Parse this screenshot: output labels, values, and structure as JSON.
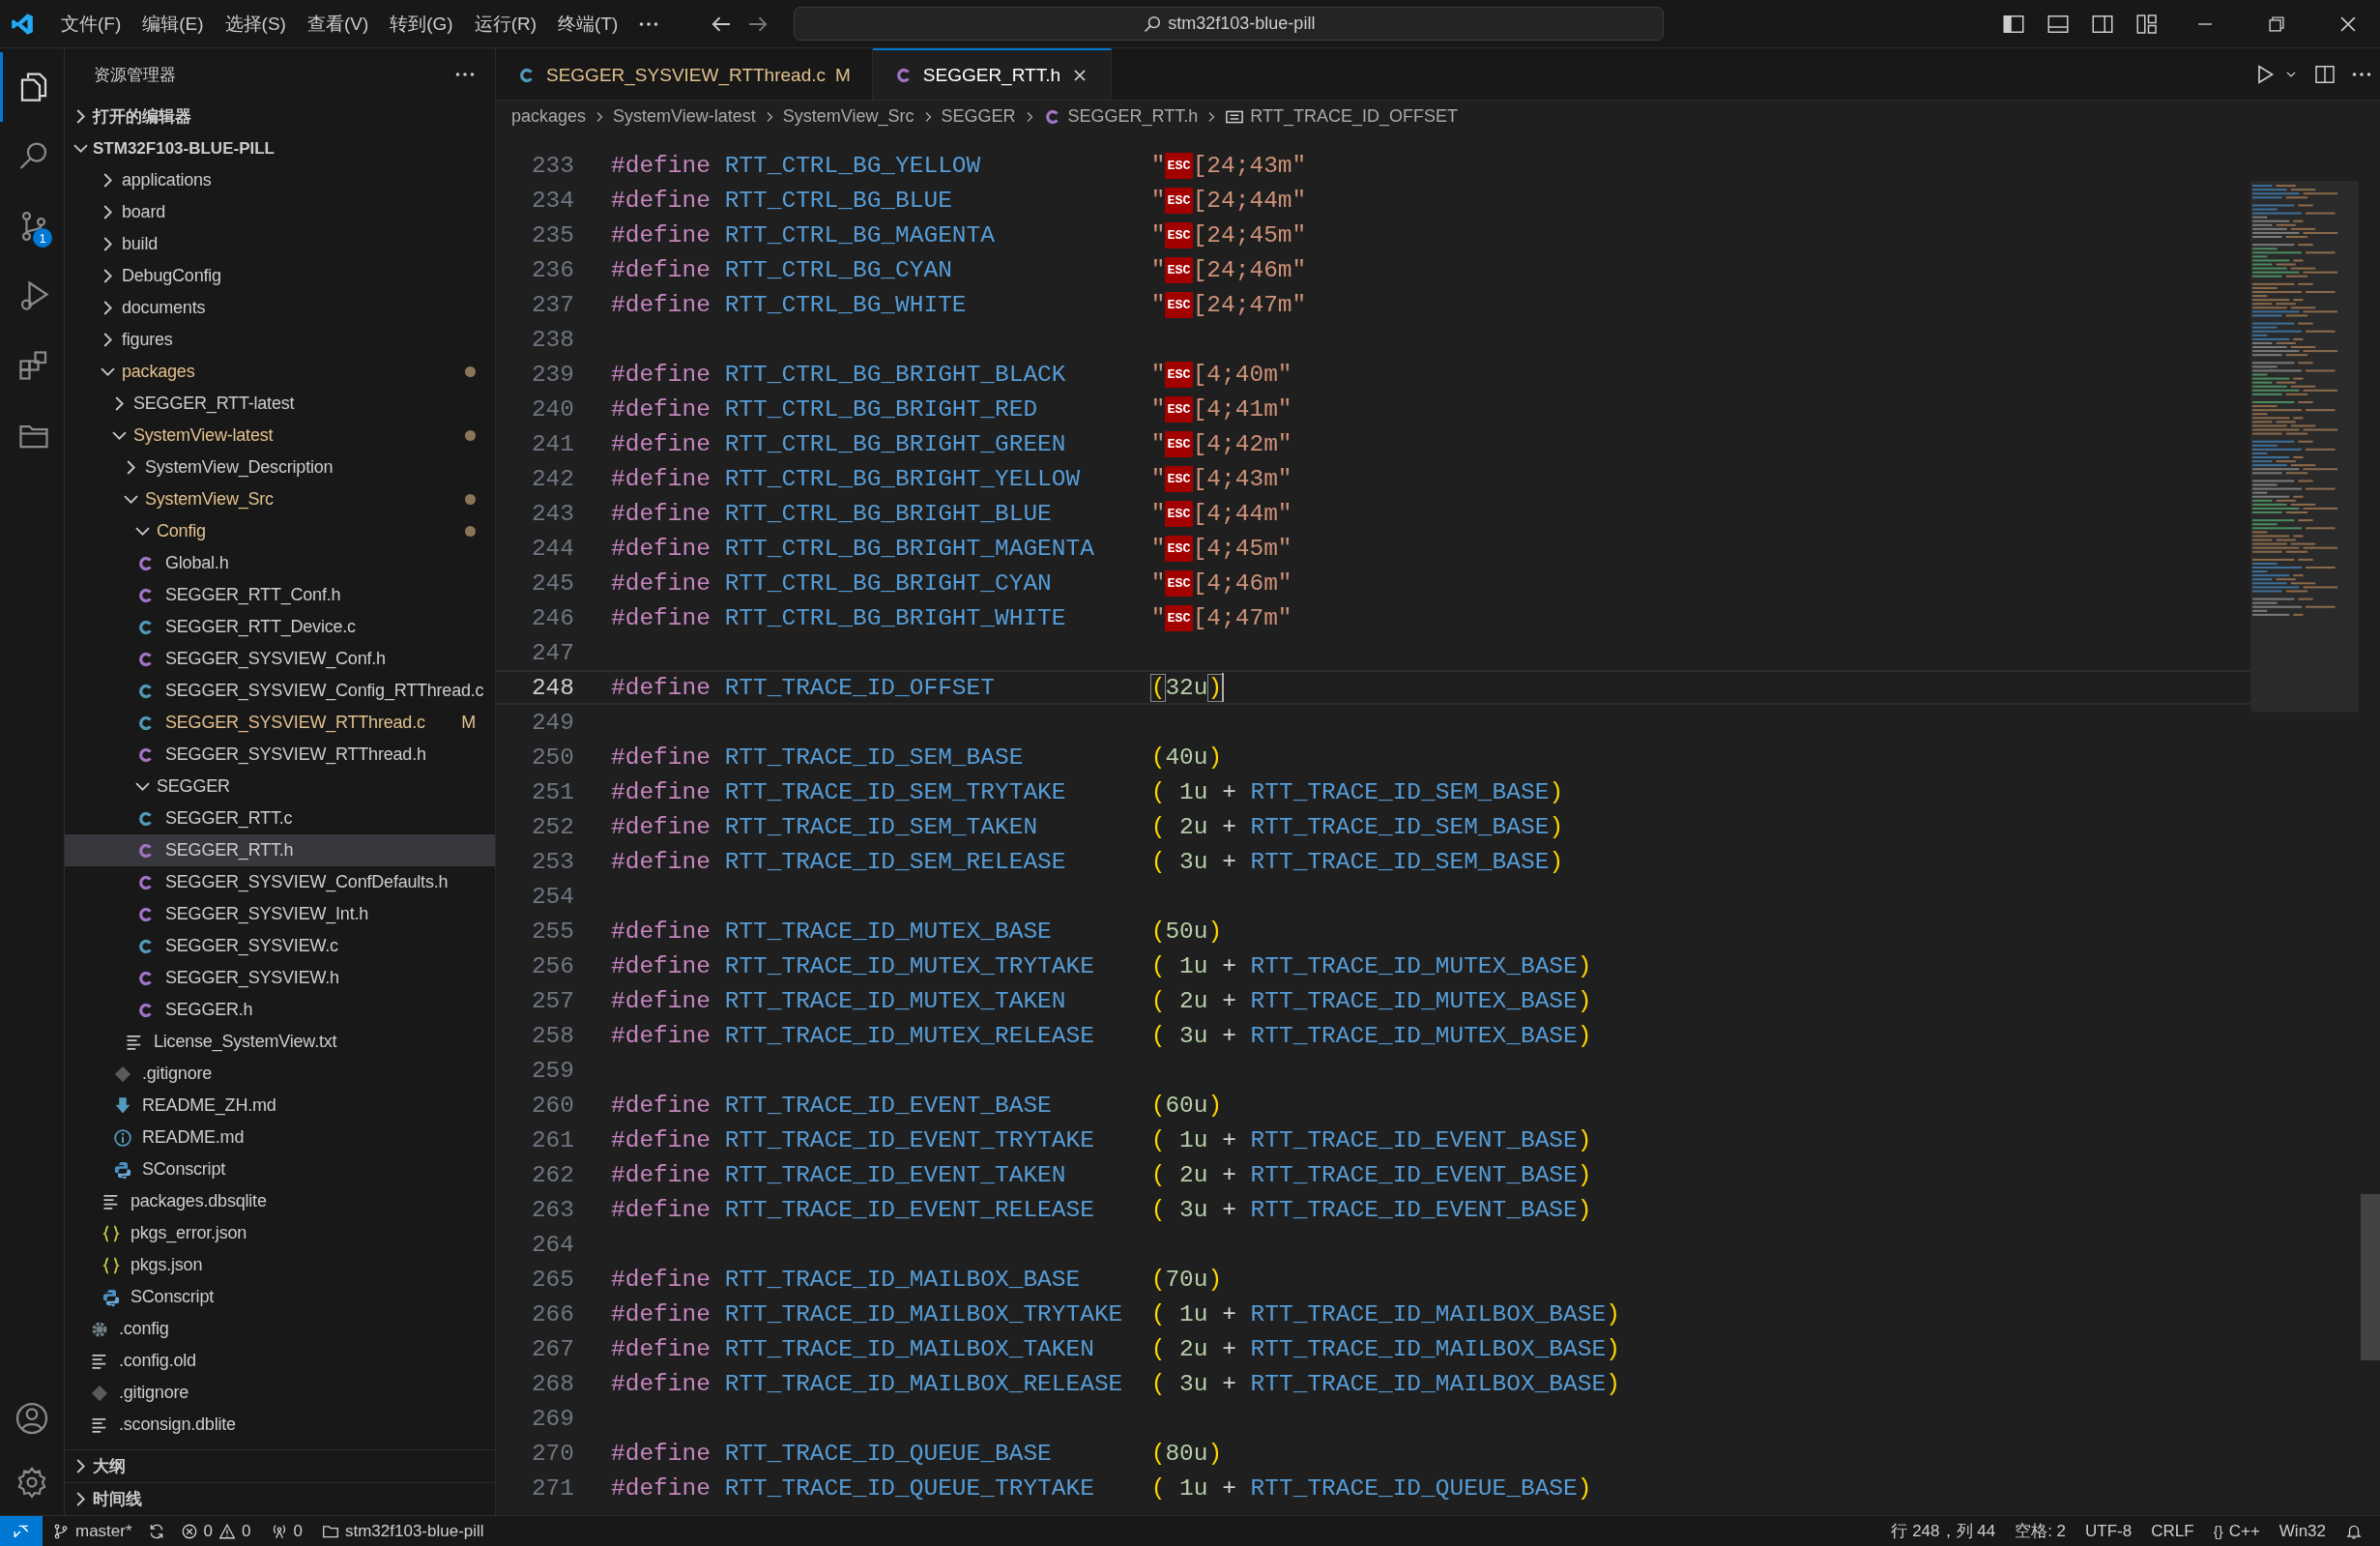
{
  "title_bar": {
    "menus": [
      "文件(F)",
      "编辑(E)",
      "选择(S)",
      "查看(V)",
      "转到(G)",
      "运行(R)",
      "终端(T)"
    ],
    "search": "stm32f103-blue-pill"
  },
  "activity_bar": [
    {
      "kind": "files",
      "selected": true
    },
    {
      "kind": "search",
      "selected": false
    },
    {
      "kind": "source-control",
      "selected": false,
      "badge": "1"
    },
    {
      "kind": "run-debug",
      "selected": false
    },
    {
      "kind": "extensions",
      "selected": false
    },
    {
      "kind": "folder",
      "selected": false
    }
  ],
  "sidebar": {
    "title": "资源管理器",
    "open_editors": {
      "label": "打开的编辑器",
      "expanded": false
    },
    "project": {
      "label": "STM32F103-BLUE-PILL",
      "expanded": true
    },
    "tree": [
      {
        "label": "applications",
        "kind": "folder",
        "expanded": false,
        "changed": false,
        "selected": false
      },
      {
        "label": "board",
        "kind": "folder",
        "expanded": false,
        "changed": false,
        "selected": false
      },
      {
        "label": "build",
        "kind": "folder",
        "expanded": false,
        "changed": false,
        "selected": false
      },
      {
        "label": "DebugConfig",
        "kind": "folder",
        "expanded": false,
        "changed": false,
        "selected": false
      },
      {
        "label": "documents",
        "kind": "folder",
        "expanded": false,
        "changed": false,
        "selected": false
      },
      {
        "label": "figures",
        "kind": "folder",
        "expanded": false,
        "changed": false,
        "selected": false
      },
      {
        "label": "packages",
        "kind": "folder",
        "expanded": true,
        "changed": true,
        "selected": false,
        "children": [
          {
            "label": "SEGGER_RTT-latest",
            "kind": "folder",
            "expanded": false,
            "changed": false,
            "selected": false
          },
          {
            "label": "SystemView-latest",
            "kind": "folder",
            "expanded": true,
            "changed": true,
            "selected": false,
            "children": [
              {
                "label": "SystemView_Description",
                "kind": "folder",
                "expanded": false,
                "changed": false,
                "selected": false
              },
              {
                "label": "SystemView_Src",
                "kind": "folder",
                "expanded": true,
                "changed": true,
                "selected": false,
                "children": [
                  {
                    "label": "Config",
                    "kind": "folder",
                    "expanded": true,
                    "changed": true,
                    "selected": false,
                    "children": [
                      {
                        "label": "Global.h",
                        "kind": "c_header",
                        "selected": false
                      },
                      {
                        "label": "SEGGER_RTT_Conf.h",
                        "kind": "c_header",
                        "selected": false
                      },
                      {
                        "label": "SEGGER_RTT_Device.c",
                        "kind": "c_source",
                        "selected": false
                      },
                      {
                        "label": "SEGGER_SYSVIEW_Conf.h",
                        "kind": "c_header",
                        "selected": false
                      },
                      {
                        "label": "SEGGER_SYSVIEW_Config_RTThread.c",
                        "kind": "c_source",
                        "selected": false
                      },
                      {
                        "label": "SEGGER_SYSVIEW_RTThread.c",
                        "kind": "c_source",
                        "selected": false,
                        "badge": "M"
                      },
                      {
                        "label": "SEGGER_SYSVIEW_RTThread.h",
                        "kind": "c_header",
                        "selected": false
                      }
                    ]
                  },
                  {
                    "label": "SEGGER",
                    "kind": "folder",
                    "expanded": true,
                    "changed": false,
                    "selected": false,
                    "children": [
                      {
                        "label": "SEGGER_RTT.c",
                        "kind": "c_source",
                        "selected": false
                      },
                      {
                        "label": "SEGGER_RTT.h",
                        "kind": "c_header",
                        "selected": true
                      },
                      {
                        "label": "SEGGER_SYSVIEW_ConfDefaults.h",
                        "kind": "c_header",
                        "selected": false
                      },
                      {
                        "label": "SEGGER_SYSVIEW_Int.h",
                        "kind": "c_header",
                        "selected": false
                      },
                      {
                        "label": "SEGGER_SYSVIEW.c",
                        "kind": "c_source",
                        "selected": false
                      },
                      {
                        "label": "SEGGER_SYSVIEW.h",
                        "kind": "c_header",
                        "selected": false
                      },
                      {
                        "label": "SEGGER.h",
                        "kind": "c_header",
                        "selected": false
                      }
                    ]
                  },
                  {
                    "label": "License_SystemView.txt",
                    "kind": "text",
                    "selected": false
                  }
                ]
              },
              {
                "label": ".gitignore",
                "kind": "git",
                "selected": false
              },
              {
                "label": "README_ZH.md",
                "kind": "download",
                "selected": false
              },
              {
                "label": "README.md",
                "kind": "info",
                "selected": false
              },
              {
                "label": "SConscript",
                "kind": "python",
                "selected": false
              }
            ]
          },
          {
            "label": "packages.dbsqlite",
            "kind": "text",
            "selected": false
          },
          {
            "label": "pkgs_error.json",
            "kind": "json",
            "selected": false
          },
          {
            "label": "pkgs.json",
            "kind": "json",
            "selected": false
          },
          {
            "label": "SConscript",
            "kind": "python",
            "selected": false
          }
        ]
      },
      {
        "label": ".config",
        "kind": "gear",
        "selected": false
      },
      {
        "label": ".config.old",
        "kind": "text",
        "selected": false
      },
      {
        "label": ".gitignore",
        "kind": "git",
        "selected": false
      },
      {
        "label": ".sconsign.dblite",
        "kind": "text",
        "selected": false
      }
    ],
    "sections": [
      {
        "label": "大纲",
        "expanded": false
      },
      {
        "label": "时间线",
        "expanded": false
      }
    ]
  },
  "tabs": [
    {
      "label": "SEGGER_SYSVIEW_RTThread.c",
      "kind": "c_source",
      "badge": "M",
      "selected": false
    },
    {
      "label": "SEGGER_RTT.h",
      "kind": "c_header",
      "selected": true
    }
  ],
  "breadcrumbs": [
    {
      "kind": "folder",
      "text": "packages"
    },
    {
      "kind": "folder",
      "text": "SystemView-latest"
    },
    {
      "kind": "folder",
      "text": "SystemView_Src"
    },
    {
      "kind": "folder",
      "text": "SEGGER"
    },
    {
      "kind": "c_header",
      "text": "SEGGER_RTT.h"
    },
    {
      "kind": "symbol",
      "text": "RTT_TRACE_ID_OFFSET"
    }
  ],
  "code": [
    {
      "number": "233",
      "current": false,
      "directive": "#define",
      "name": "RTT_CTRL_BG_YELLOW",
      "value": [
        {
          "kind": "string",
          "text": "\""
        },
        {
          "kind": "control",
          "text": "ESC"
        },
        {
          "kind": "string",
          "text": "[24;43m\""
        }
      ]
    },
    {
      "number": "234",
      "current": false,
      "directive": "#define",
      "name": "RTT_CTRL_BG_BLUE",
      "value": [
        {
          "kind": "string",
          "text": "\""
        },
        {
          "kind": "control",
          "text": "ESC"
        },
        {
          "kind": "string",
          "text": "[24;44m\""
        }
      ]
    },
    {
      "number": "235",
      "current": false,
      "directive": "#define",
      "name": "RTT_CTRL_BG_MAGENTA",
      "value": [
        {
          "kind": "string",
          "text": "\""
        },
        {
          "kind": "control",
          "text": "ESC"
        },
        {
          "kind": "string",
          "text": "[24;45m\""
        }
      ]
    },
    {
      "number": "236",
      "current": false,
      "directive": "#define",
      "name": "RTT_CTRL_BG_CYAN",
      "value": [
        {
          "kind": "string",
          "text": "\""
        },
        {
          "kind": "control",
          "text": "ESC"
        },
        {
          "kind": "string",
          "text": "[24;46m\""
        }
      ]
    },
    {
      "number": "237",
      "current": false,
      "directive": "#define",
      "name": "RTT_CTRL_BG_WHITE",
      "value": [
        {
          "kind": "string",
          "text": "\""
        },
        {
          "kind": "control",
          "text": "ESC"
        },
        {
          "kind": "string",
          "text": "[24;47m\""
        }
      ]
    },
    {
      "number": "238",
      "current": false
    },
    {
      "number": "239",
      "current": false,
      "directive": "#define",
      "name": "RTT_CTRL_BG_BRIGHT_BLACK",
      "value": [
        {
          "kind": "string",
          "text": "\""
        },
        {
          "kind": "control",
          "text": "ESC"
        },
        {
          "kind": "string",
          "text": "[4;40m\""
        }
      ]
    },
    {
      "number": "240",
      "current": false,
      "directive": "#define",
      "name": "RTT_CTRL_BG_BRIGHT_RED",
      "value": [
        {
          "kind": "string",
          "text": "\""
        },
        {
          "kind": "control",
          "text": "ESC"
        },
        {
          "kind": "string",
          "text": "[4;41m\""
        }
      ]
    },
    {
      "number": "241",
      "current": false,
      "directive": "#define",
      "name": "RTT_CTRL_BG_BRIGHT_GREEN",
      "value": [
        {
          "kind": "string",
          "text": "\""
        },
        {
          "kind": "control",
          "text": "ESC"
        },
        {
          "kind": "string",
          "text": "[4;42m\""
        }
      ]
    },
    {
      "number": "242",
      "current": false,
      "directive": "#define",
      "name": "RTT_CTRL_BG_BRIGHT_YELLOW",
      "value": [
        {
          "kind": "string",
          "text": "\""
        },
        {
          "kind": "control",
          "text": "ESC"
        },
        {
          "kind": "string",
          "text": "[4;43m\""
        }
      ]
    },
    {
      "number": "243",
      "current": false,
      "directive": "#define",
      "name": "RTT_CTRL_BG_BRIGHT_BLUE",
      "value": [
        {
          "kind": "string",
          "text": "\""
        },
        {
          "kind": "control",
          "text": "ESC"
        },
        {
          "kind": "string",
          "text": "[4;44m\""
        }
      ]
    },
    {
      "number": "244",
      "current": false,
      "directive": "#define",
      "name": "RTT_CTRL_BG_BRIGHT_MAGENTA",
      "value": [
        {
          "kind": "string",
          "text": "\""
        },
        {
          "kind": "control",
          "text": "ESC"
        },
        {
          "kind": "string",
          "text": "[4;45m\""
        }
      ]
    },
    {
      "number": "245",
      "current": false,
      "directive": "#define",
      "name": "RTT_CTRL_BG_BRIGHT_CYAN",
      "value": [
        {
          "kind": "string",
          "text": "\""
        },
        {
          "kind": "control",
          "text": "ESC"
        },
        {
          "kind": "string",
          "text": "[4;46m\""
        }
      ]
    },
    {
      "number": "246",
      "current": false,
      "directive": "#define",
      "name": "RTT_CTRL_BG_BRIGHT_WHITE",
      "value": [
        {
          "kind": "string",
          "text": "\""
        },
        {
          "kind": "control",
          "text": "ESC"
        },
        {
          "kind": "string",
          "text": "[4;47m\""
        }
      ]
    },
    {
      "number": "247",
      "current": false
    },
    {
      "number": "248",
      "current": true,
      "directive": "#define",
      "name": "RTT_TRACE_ID_OFFSET",
      "value": [
        {
          "kind": "matched_bracket",
          "text": "("
        },
        {
          "kind": "number",
          "text": "32u"
        },
        {
          "kind": "matched_bracket",
          "text": ")"
        }
      ]
    },
    {
      "number": "249",
      "current": false
    },
    {
      "number": "250",
      "current": false,
      "directive": "#define",
      "name": "RTT_TRACE_ID_SEM_BASE",
      "value": [
        {
          "kind": "bracket",
          "text": "("
        },
        {
          "kind": "number",
          "text": "40u"
        },
        {
          "kind": "bracket",
          "text": ")"
        }
      ]
    },
    {
      "number": "251",
      "current": false,
      "directive": "#define",
      "name": "RTT_TRACE_ID_SEM_TRYTAKE",
      "value": [
        {
          "kind": "bracket",
          "text": "("
        },
        {
          "kind": "number",
          "text": " 1u"
        },
        {
          "kind": "operator",
          "text": " + "
        },
        {
          "kind": "macro",
          "text": "RTT_TRACE_ID_SEM_BASE"
        },
        {
          "kind": "bracket",
          "text": ")"
        }
      ]
    },
    {
      "number": "252",
      "current": false,
      "directive": "#define",
      "name": "RTT_TRACE_ID_SEM_TAKEN",
      "value": [
        {
          "kind": "bracket",
          "text": "("
        },
        {
          "kind": "number",
          "text": " 2u"
        },
        {
          "kind": "operator",
          "text": " + "
        },
        {
          "kind": "macro",
          "text": "RTT_TRACE_ID_SEM_BASE"
        },
        {
          "kind": "bracket",
          "text": ")"
        }
      ]
    },
    {
      "number": "253",
      "current": false,
      "directive": "#define",
      "name": "RTT_TRACE_ID_SEM_RELEASE",
      "value": [
        {
          "kind": "bracket",
          "text": "("
        },
        {
          "kind": "number",
          "text": " 3u"
        },
        {
          "kind": "operator",
          "text": " + "
        },
        {
          "kind": "macro",
          "text": "RTT_TRACE_ID_SEM_BASE"
        },
        {
          "kind": "bracket",
          "text": ")"
        }
      ]
    },
    {
      "number": "254",
      "current": false
    },
    {
      "number": "255",
      "current": false,
      "directive": "#define",
      "name": "RTT_TRACE_ID_MUTEX_BASE",
      "value": [
        {
          "kind": "bracket",
          "text": "("
        },
        {
          "kind": "number",
          "text": "50u"
        },
        {
          "kind": "bracket",
          "text": ")"
        }
      ]
    },
    {
      "number": "256",
      "current": false,
      "directive": "#define",
      "name": "RTT_TRACE_ID_MUTEX_TRYTAKE",
      "value": [
        {
          "kind": "bracket",
          "text": "("
        },
        {
          "kind": "number",
          "text": " 1u"
        },
        {
          "kind": "operator",
          "text": " + "
        },
        {
          "kind": "macro",
          "text": "RTT_TRACE_ID_MUTEX_BASE"
        },
        {
          "kind": "bracket",
          "text": ")"
        }
      ]
    },
    {
      "number": "257",
      "current": false,
      "directive": "#define",
      "name": "RTT_TRACE_ID_MUTEX_TAKEN",
      "value": [
        {
          "kind": "bracket",
          "text": "("
        },
        {
          "kind": "number",
          "text": " 2u"
        },
        {
          "kind": "operator",
          "text": " + "
        },
        {
          "kind": "macro",
          "text": "RTT_TRACE_ID_MUTEX_BASE"
        },
        {
          "kind": "bracket",
          "text": ")"
        }
      ]
    },
    {
      "number": "258",
      "current": false,
      "directive": "#define",
      "name": "RTT_TRACE_ID_MUTEX_RELEASE",
      "value": [
        {
          "kind": "bracket",
          "text": "("
        },
        {
          "kind": "number",
          "text": " 3u"
        },
        {
          "kind": "operator",
          "text": " + "
        },
        {
          "kind": "macro",
          "text": "RTT_TRACE_ID_MUTEX_BASE"
        },
        {
          "kind": "bracket",
          "text": ")"
        }
      ]
    },
    {
      "number": "259",
      "current": false
    },
    {
      "number": "260",
      "current": false,
      "directive": "#define",
      "name": "RTT_TRACE_ID_EVENT_BASE",
      "value": [
        {
          "kind": "bracket",
          "text": "("
        },
        {
          "kind": "number",
          "text": "60u"
        },
        {
          "kind": "bracket",
          "text": ")"
        }
      ]
    },
    {
      "number": "261",
      "current": false,
      "directive": "#define",
      "name": "RTT_TRACE_ID_EVENT_TRYTAKE",
      "value": [
        {
          "kind": "bracket",
          "text": "("
        },
        {
          "kind": "number",
          "text": " 1u"
        },
        {
          "kind": "operator",
          "text": " + "
        },
        {
          "kind": "macro",
          "text": "RTT_TRACE_ID_EVENT_BASE"
        },
        {
          "kind": "bracket",
          "text": ")"
        }
      ]
    },
    {
      "number": "262",
      "current": false,
      "directive": "#define",
      "name": "RTT_TRACE_ID_EVENT_TAKEN",
      "value": [
        {
          "kind": "bracket",
          "text": "("
        },
        {
          "kind": "number",
          "text": " 2u"
        },
        {
          "kind": "operator",
          "text": " + "
        },
        {
          "kind": "macro",
          "text": "RTT_TRACE_ID_EVENT_BASE"
        },
        {
          "kind": "bracket",
          "text": ")"
        }
      ]
    },
    {
      "number": "263",
      "current": false,
      "directive": "#define",
      "name": "RTT_TRACE_ID_EVENT_RELEASE",
      "value": [
        {
          "kind": "bracket",
          "text": "("
        },
        {
          "kind": "number",
          "text": " 3u"
        },
        {
          "kind": "operator",
          "text": " + "
        },
        {
          "kind": "macro",
          "text": "RTT_TRACE_ID_EVENT_BASE"
        },
        {
          "kind": "bracket",
          "text": ")"
        }
      ]
    },
    {
      "number": "264",
      "current": false
    },
    {
      "number": "265",
      "current": false,
      "directive": "#define",
      "name": "RTT_TRACE_ID_MAILBOX_BASE",
      "value": [
        {
          "kind": "bracket",
          "text": "("
        },
        {
          "kind": "number",
          "text": "70u"
        },
        {
          "kind": "bracket",
          "text": ")"
        }
      ]
    },
    {
      "number": "266",
      "current": false,
      "directive": "#define",
      "name": "RTT_TRACE_ID_MAILBOX_TRYTAKE",
      "value": [
        {
          "kind": "bracket",
          "text": "("
        },
        {
          "kind": "number",
          "text": " 1u"
        },
        {
          "kind": "operator",
          "text": " + "
        },
        {
          "kind": "macro",
          "text": "RTT_TRACE_ID_MAILBOX_BASE"
        },
        {
          "kind": "bracket",
          "text": ")"
        }
      ]
    },
    {
      "number": "267",
      "current": false,
      "directive": "#define",
      "name": "RTT_TRACE_ID_MAILBOX_TAKEN",
      "value": [
        {
          "kind": "bracket",
          "text": "("
        },
        {
          "kind": "number",
          "text": " 2u"
        },
        {
          "kind": "operator",
          "text": " + "
        },
        {
          "kind": "macro",
          "text": "RTT_TRACE_ID_MAILBOX_BASE"
        },
        {
          "kind": "bracket",
          "text": ")"
        }
      ]
    },
    {
      "number": "268",
      "current": false,
      "directive": "#define",
      "name": "RTT_TRACE_ID_MAILBOX_RELEASE",
      "value": [
        {
          "kind": "bracket",
          "text": "("
        },
        {
          "kind": "number",
          "text": " 3u"
        },
        {
          "kind": "operator",
          "text": " + "
        },
        {
          "kind": "macro",
          "text": "RTT_TRACE_ID_MAILBOX_BASE"
        },
        {
          "kind": "bracket",
          "text": ")"
        }
      ]
    },
    {
      "number": "269",
      "current": false
    },
    {
      "number": "270",
      "current": false,
      "directive": "#define",
      "name": "RTT_TRACE_ID_QUEUE_BASE",
      "value": [
        {
          "kind": "bracket",
          "text": "("
        },
        {
          "kind": "number",
          "text": "80u"
        },
        {
          "kind": "bracket",
          "text": ")"
        }
      ]
    },
    {
      "number": "271",
      "current": false,
      "directive": "#define",
      "name": "RTT_TRACE_ID_QUEUE_TRYTAKE",
      "value": [
        {
          "kind": "bracket",
          "text": "("
        },
        {
          "kind": "number",
          "text": " 1u"
        },
        {
          "kind": "operator",
          "text": " + "
        },
        {
          "kind": "macro",
          "text": "RTT_TRACE_ID_QUEUE_BASE"
        },
        {
          "kind": "bracket",
          "text": ")"
        }
      ]
    }
  ],
  "status_bar": {
    "branch": "master*",
    "errors": "0",
    "warnings": "0",
    "ports": "0",
    "folder": "stm32f103-blue-pill",
    "right": [
      {
        "kind": "text",
        "text": "行 248，列 44"
      },
      {
        "kind": "text",
        "text": "空格: 2"
      },
      {
        "kind": "text",
        "text": "UTF-8"
      },
      {
        "kind": "text",
        "text": "CRLF"
      },
      {
        "kind": "language",
        "icon": "{}",
        "text": "C++"
      },
      {
        "kind": "text",
        "text": "Win32"
      },
      {
        "kind": "bell"
      }
    ]
  }
}
